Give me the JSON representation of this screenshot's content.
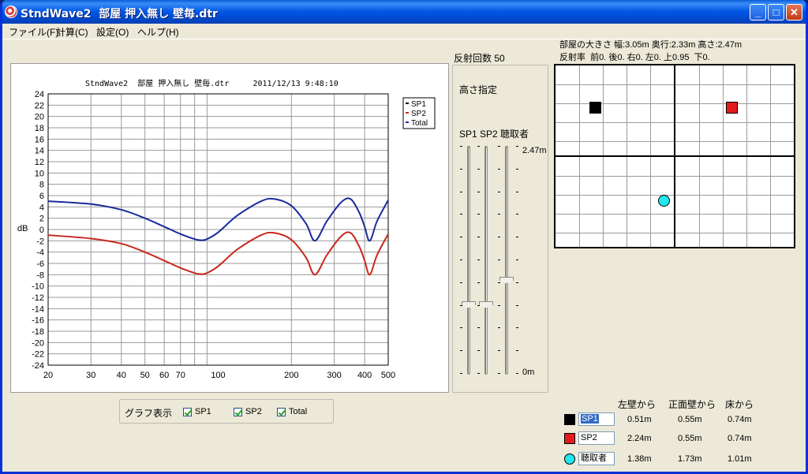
{
  "window": {
    "title": "StndWave2  部屋 押入無し 壁毎.dtr",
    "minimize": "_",
    "maximize": "□",
    "close": "✕"
  },
  "menu": [
    "ファイル(F)",
    "計算(C)",
    "設定(O)",
    "ヘルプ(H)"
  ],
  "graph": {
    "title": "StndWave2  部屋 押入無し 壁毎.dtr     2011/12/13 9:48:10",
    "ylabel": "dB"
  },
  "graph_options": {
    "label": "グラフ表示",
    "checkboxes": [
      {
        "label": "SP1",
        "checked": true
      },
      {
        "label": "SP2",
        "checked": true
      },
      {
        "label": "Total",
        "checked": true
      }
    ]
  },
  "reflection_count": "反射回数 50",
  "height_panel": {
    "title": "高さ指定",
    "columns": "SP1 SP2 聴取者",
    "top_label": "2.47m",
    "bottom_label": "0m",
    "sliders": [
      {
        "name": "SP1",
        "level": 0.3
      },
      {
        "name": "SP2",
        "level": 0.3
      },
      {
        "name": "聴取者",
        "level": 0.41
      }
    ]
  },
  "room": {
    "size_text": "部屋の大きさ 幅:3.05m 奥行:2.33m 高さ:2.47m",
    "reflect_text": "反射率  前0. 後0. 右0. 左0. 上0.95  下0."
  },
  "positions": {
    "headers": [
      "左壁から",
      "正面壁から",
      "床から"
    ],
    "rows": [
      {
        "name": "SP1",
        "color": "#000000",
        "shape": "square",
        "left": "0.51m",
        "front": "0.55m",
        "floor": "0.74m",
        "selected": true
      },
      {
        "name": "SP2",
        "color": "#e31b1b",
        "shape": "square",
        "left": "2.24m",
        "front": "0.55m",
        "floor": "0.74m",
        "selected": false
      },
      {
        "name": "聴取者",
        "color": "#22e6f0",
        "shape": "circle",
        "left": "1.38m",
        "front": "1.73m",
        "floor": "1.01m",
        "selected": false
      }
    ]
  },
  "chart_data": {
    "type": "line",
    "xscale": "log",
    "xlim": [
      20,
      500
    ],
    "ylim": [
      -24,
      24
    ],
    "ylabel": "dB",
    "xticks": [
      20,
      30,
      40,
      50,
      60,
      70,
      100,
      200,
      300,
      400,
      500
    ],
    "yticks": [
      24,
      22,
      20,
      18,
      16,
      14,
      12,
      10,
      8,
      6,
      4,
      2,
      0,
      -2,
      -4,
      -6,
      -8,
      -10,
      -12,
      -14,
      -16,
      -18,
      -20,
      -22,
      -24
    ],
    "legend": [
      "SP1",
      "SP2",
      "Total"
    ],
    "legend_position": "top-right",
    "series": [
      {
        "name": "SP1",
        "color": "#000000",
        "x": [],
        "y": []
      },
      {
        "name": "Total",
        "color": "#1a2b9a",
        "x": [
          20,
          30,
          40,
          50,
          60,
          70,
          80,
          85,
          90,
          100,
          120,
          150,
          170,
          200,
          230,
          250,
          280,
          320,
          350,
          380,
          400,
          420,
          450,
          500
        ],
        "y": [
          5,
          4.5,
          3.5,
          2,
          0.5,
          -0.8,
          -1.7,
          -1.9,
          -1.7,
          -0.5,
          2.5,
          5,
          5.4,
          4.2,
          1,
          -2,
          1.5,
          4.8,
          5.4,
          3,
          0.5,
          -2,
          1.5,
          5.2
        ]
      },
      {
        "name": "SP2",
        "color": "#c8281e",
        "x": [
          20,
          30,
          40,
          50,
          60,
          70,
          80,
          85,
          90,
          100,
          120,
          150,
          170,
          200,
          230,
          250,
          280,
          320,
          350,
          380,
          400,
          420,
          450,
          500
        ],
        "y": [
          -1,
          -1.6,
          -2.5,
          -4,
          -5.5,
          -6.8,
          -7.7,
          -7.9,
          -7.7,
          -6.5,
          -3.5,
          -1,
          -0.6,
          -1.8,
          -5,
          -8,
          -4.5,
          -1.2,
          -0.6,
          -3,
          -5.5,
          -8,
          -4.5,
          -0.8
        ]
      }
    ]
  }
}
